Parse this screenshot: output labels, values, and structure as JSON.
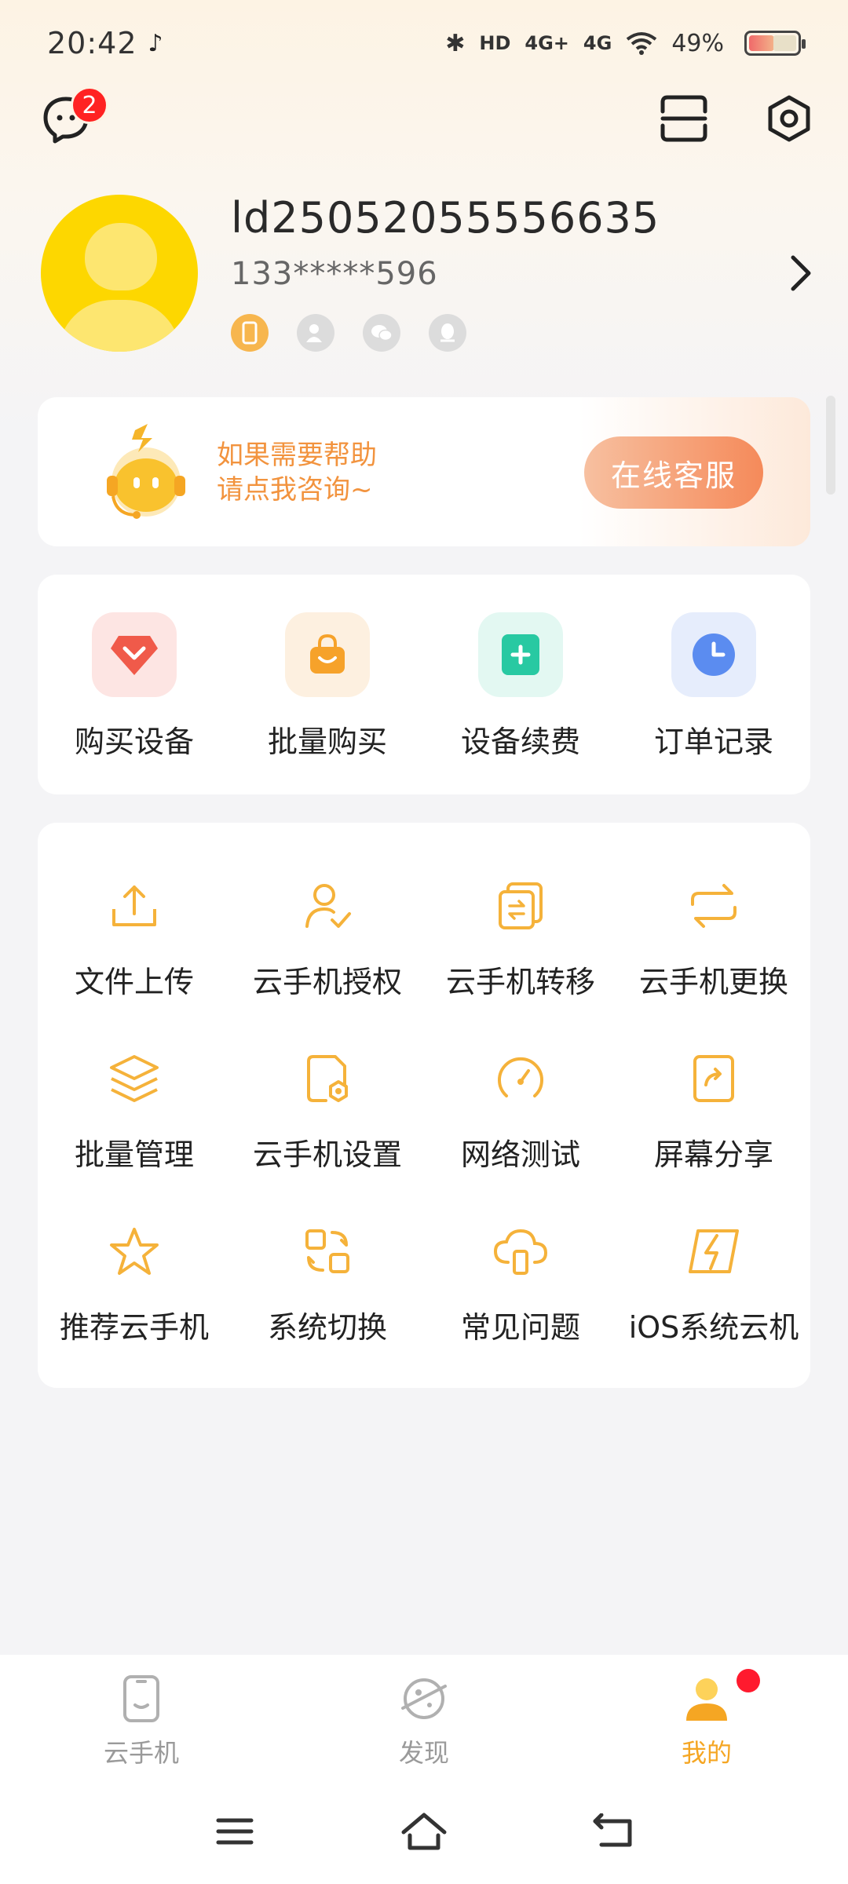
{
  "status_bar": {
    "time": "20:42",
    "network_a": "4G+",
    "network_b": "4G",
    "battery": "49%"
  },
  "header": {
    "message_badge": "2"
  },
  "profile": {
    "user_id": "ld25052055556635",
    "phone": "133*****596"
  },
  "help_banner": {
    "line1": "如果需要帮助",
    "line2": "请点我咨询~",
    "button_label": "在线客服"
  },
  "shop": [
    {
      "label": "购买设备",
      "icon": "diamond-icon",
      "color": "#f05a4a"
    },
    {
      "label": "批量购买",
      "icon": "shopping-bag-icon",
      "color": "#f6a22a"
    },
    {
      "label": "设备续费",
      "icon": "plus-icon",
      "color": "#28c9a2"
    },
    {
      "label": "订单记录",
      "icon": "clock-icon",
      "color": "#5b8cf0"
    }
  ],
  "tools": [
    {
      "label": "文件上传",
      "icon": "upload-icon"
    },
    {
      "label": "云手机授权",
      "icon": "user-check-icon"
    },
    {
      "label": "云手机转移",
      "icon": "transfer-icon"
    },
    {
      "label": "云手机更换",
      "icon": "swap-icon"
    },
    {
      "label": "批量管理",
      "icon": "layers-icon"
    },
    {
      "label": "云手机设置",
      "icon": "device-settings-icon"
    },
    {
      "label": "网络测试",
      "icon": "speedometer-icon"
    },
    {
      "label": "屏幕分享",
      "icon": "share-screen-icon"
    },
    {
      "label": "推荐云手机",
      "icon": "star-icon"
    },
    {
      "label": "系统切换",
      "icon": "system-switch-icon"
    },
    {
      "label": "常见问题",
      "icon": "cloud-phone-icon"
    },
    {
      "label": "iOS系统云机",
      "icon": "lightning-icon"
    }
  ],
  "bottom_nav": [
    {
      "label": "云手机",
      "icon": "phone-icon"
    },
    {
      "label": "发现",
      "icon": "planet-icon"
    },
    {
      "label": "我的",
      "icon": "profile-icon",
      "active": true
    }
  ],
  "colors": {
    "accent": "#f5a623",
    "tool_icon": "#f5b23a",
    "badge": "#ff1a2e"
  }
}
